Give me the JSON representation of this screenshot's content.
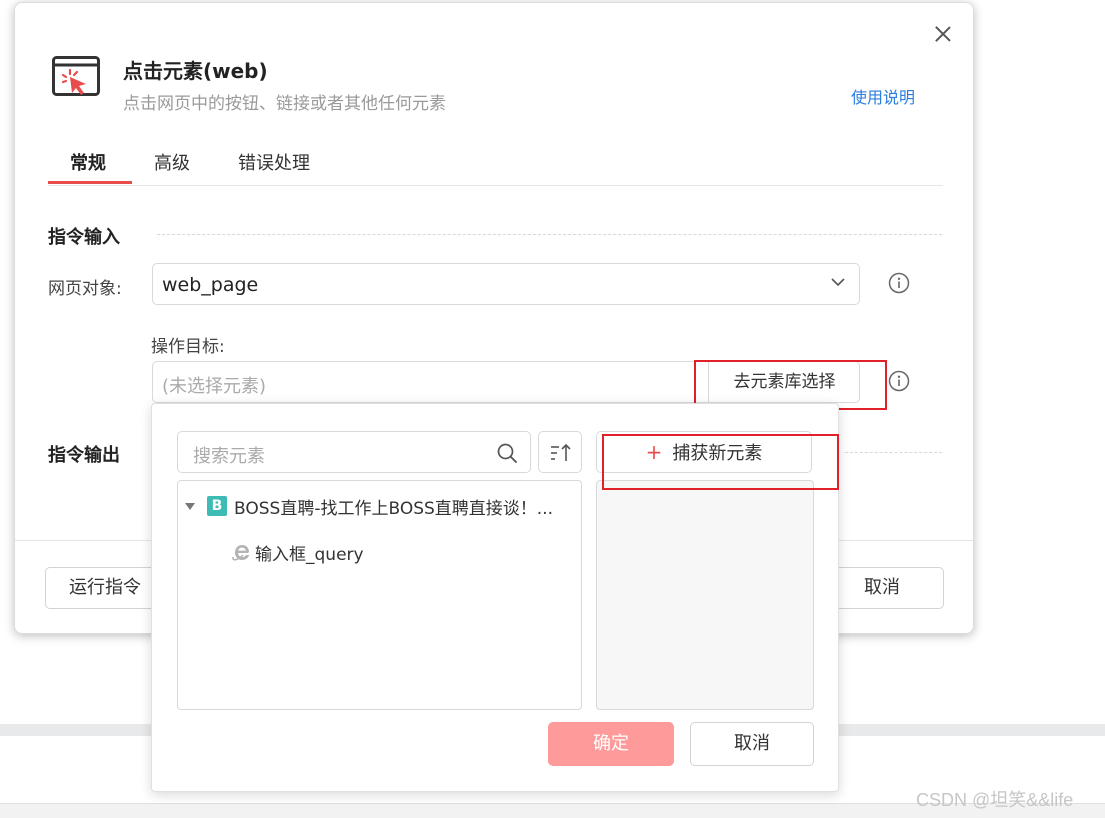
{
  "dialog": {
    "title": "点击元素(web)",
    "subtitle": "点击网页中的按钮、链接或者其他任何元素",
    "help_link": "使用说明",
    "header_icon": "click-cursor-icon"
  },
  "tabs": [
    {
      "label": "常规",
      "active": true
    },
    {
      "label": "高级",
      "active": false
    },
    {
      "label": "错误处理",
      "active": false
    }
  ],
  "sections": {
    "input_title": "指令输入",
    "output_title": "指令输出"
  },
  "fields": {
    "web_page_label": "网页对象:",
    "web_page_value": "web_page",
    "target_label": "操作目标:",
    "target_placeholder": "(未选择元素)",
    "pick_button": "去元素库选择"
  },
  "footer": {
    "run_button": "运行指令",
    "cancel_button": "取消"
  },
  "popup": {
    "search_placeholder": "搜索元素",
    "capture_button": "捕获新元素",
    "tree": {
      "site_badge": "B",
      "site_label": "BOSS直聘-找工作上BOSS直聘直接谈！...",
      "children": [
        {
          "label": "输入框_query",
          "icon": "ie-browser-icon"
        }
      ]
    },
    "confirm_button": "确定",
    "cancel_button": "取消"
  },
  "colors": {
    "accent": "#e84d4d",
    "link": "#2a7de1",
    "confirm_bg": "#ff9a9a",
    "highlight_box": "#e0202a",
    "site_badge": "#3cbcb4"
  },
  "watermark": "CSDN @坦笑&&life"
}
